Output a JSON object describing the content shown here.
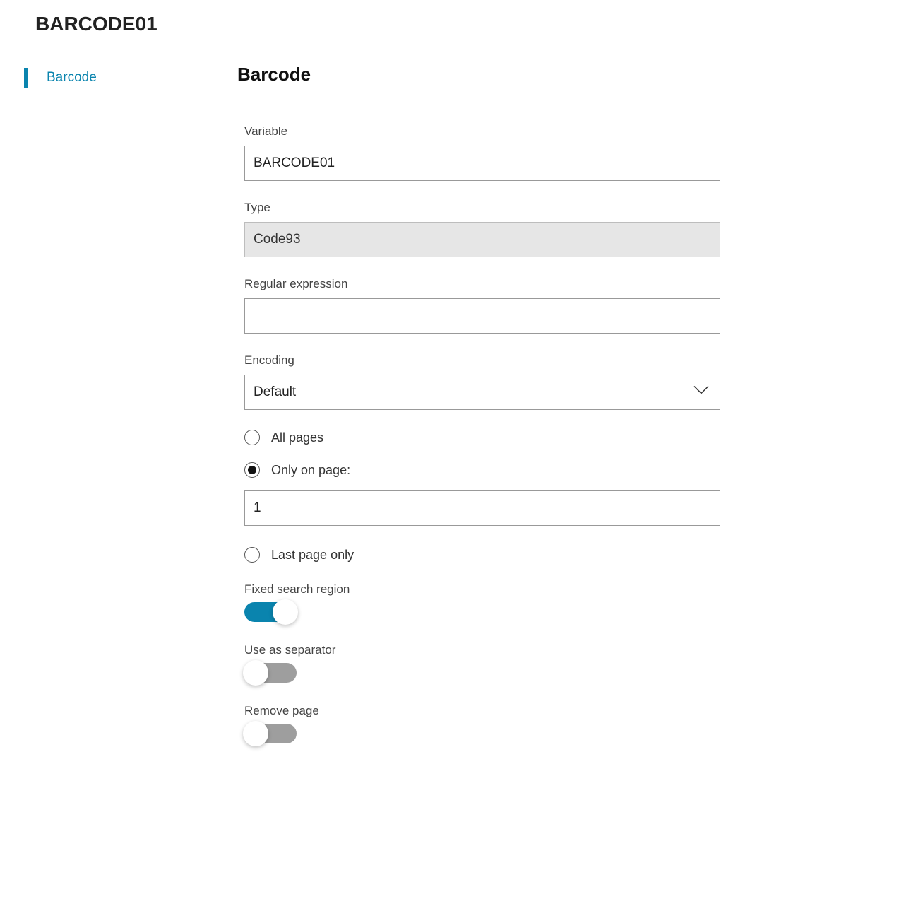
{
  "header": {
    "title": "BARCODE01"
  },
  "sidebar": {
    "items": [
      {
        "label": "Barcode",
        "active": true
      }
    ]
  },
  "main": {
    "section_title": "Barcode",
    "fields": {
      "variable": {
        "label": "Variable",
        "value": "BARCODE01"
      },
      "type": {
        "label": "Type",
        "value": "Code93"
      },
      "regex": {
        "label": "Regular expression",
        "value": ""
      },
      "encoding": {
        "label": "Encoding",
        "value": "Default"
      }
    },
    "page_scope": {
      "all_pages": {
        "label": "All pages",
        "selected": false
      },
      "only_on_page": {
        "label": "Only on page:",
        "selected": true,
        "value": "1"
      },
      "last_page_only": {
        "label": "Last page only",
        "selected": false
      }
    },
    "toggles": {
      "fixed_search_region": {
        "label": "Fixed search region",
        "on": true
      },
      "use_as_separator": {
        "label": "Use as separator",
        "on": false
      },
      "remove_page": {
        "label": "Remove page",
        "on": false
      }
    }
  }
}
